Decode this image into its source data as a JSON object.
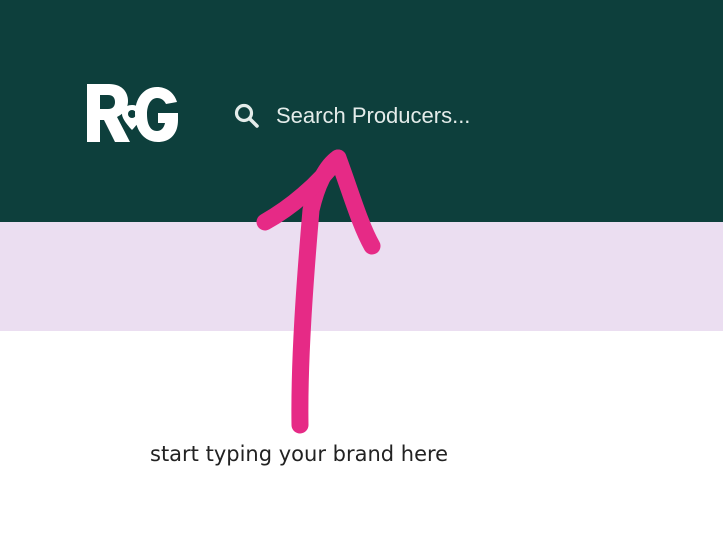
{
  "header": {
    "background_color": "#0d3f3c",
    "logo": {
      "icon": "rg-logo-icon"
    },
    "search": {
      "icon": "search-icon",
      "placeholder": "Search Producers..."
    }
  },
  "band": {
    "color": "#ebdef1"
  },
  "annotation": {
    "arrow_color": "#e62a86",
    "text": "start typing your brand here"
  }
}
